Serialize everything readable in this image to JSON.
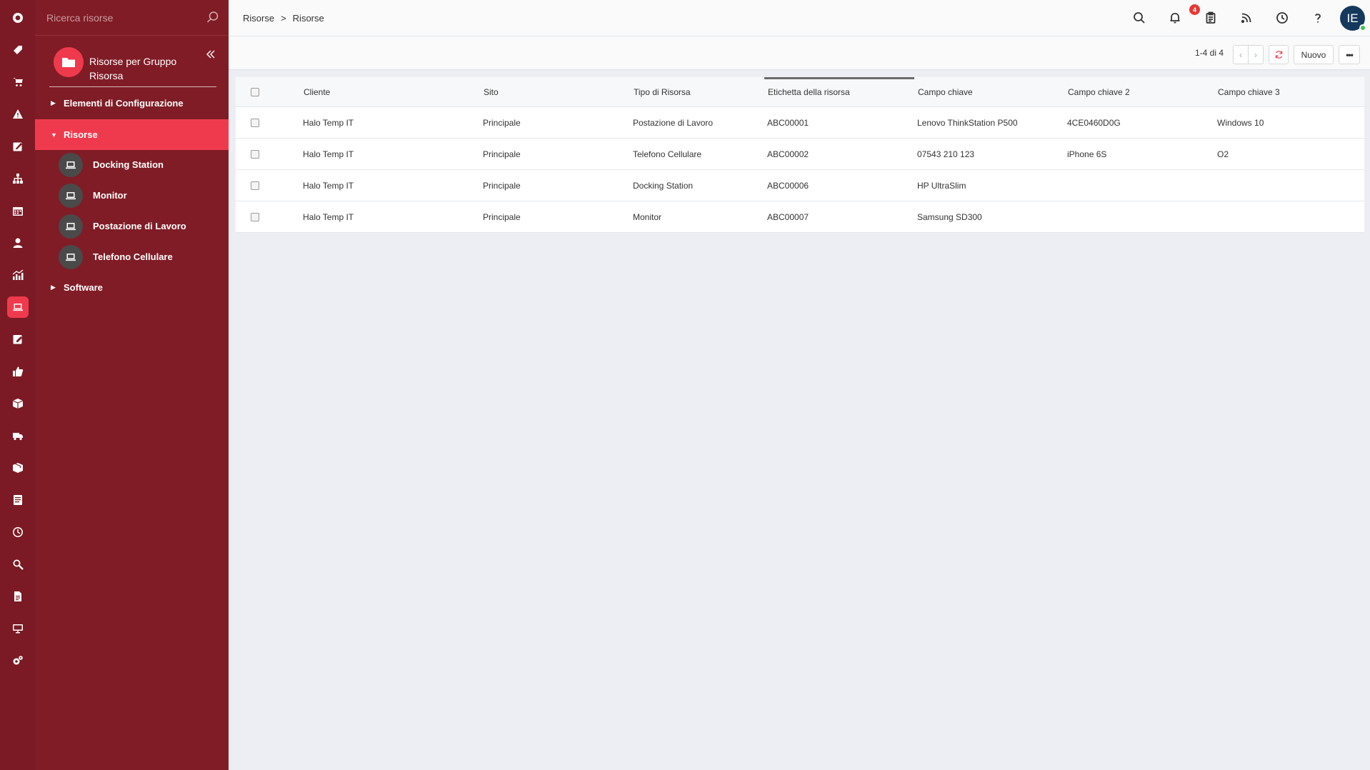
{
  "rail": {
    "items": [
      "tag-icon",
      "cart-icon",
      "warning-icon",
      "edit-icon",
      "sitemap-icon",
      "calendar-icon",
      "user-icon",
      "chart-icon",
      "laptop-icon",
      "note-icon",
      "thumbs-up-icon",
      "box-icon",
      "truck-icon",
      "package-icon",
      "document-icon",
      "clock-icon",
      "search-icon",
      "file-icon",
      "monitor-icon",
      "settings-icon"
    ],
    "active": "laptop-icon"
  },
  "tree": {
    "search_placeholder": "Ricerca risorse",
    "group_title": "Risorse per Gruppo Risorsa",
    "nodes": [
      {
        "label": "Elementi di Configurazione",
        "expanded": false
      },
      {
        "label": "Risorse",
        "expanded": true
      },
      {
        "label": "Software",
        "expanded": false
      }
    ],
    "children": [
      "Docking Station",
      "Monitor",
      "Postazione di Lavoro",
      "Telefono Cellulare"
    ]
  },
  "header": {
    "breadcrumb": [
      "Risorse",
      ">",
      "Risorse"
    ],
    "notification_count": "4",
    "avatar_initials": "IE",
    "icons": [
      "search-icon",
      "bell-icon",
      "clipboard-icon",
      "rss-icon",
      "clock-icon",
      "help-icon"
    ]
  },
  "toolbar": {
    "count": "1-4 di 4",
    "new_label": "Nuovo",
    "more_label": "•••"
  },
  "table": {
    "columns": [
      "Cliente",
      "Sito",
      "Tipo di Risorsa",
      "Etichetta della risorsa",
      "Campo chiave",
      "Campo chiave 2",
      "Campo chiave 3"
    ],
    "sorted_column": "Etichetta della risorsa",
    "rows": [
      [
        "Halo Temp IT",
        "Principale",
        "Postazione di Lavoro",
        "ABC00001",
        "Lenovo ThinkStation P500",
        "4CE0460D0G",
        "Windows 10"
      ],
      [
        "Halo Temp IT",
        "Principale",
        "Telefono Cellulare",
        "ABC00002",
        "07543 210 123",
        "iPhone 6S",
        "O2"
      ],
      [
        "Halo Temp IT",
        "Principale",
        "Docking Station",
        "ABC00006",
        "HP UltraSlim",
        "",
        ""
      ],
      [
        "Halo Temp IT",
        "Principale",
        "Monitor",
        "ABC00007",
        "Samsung SD300",
        "",
        ""
      ]
    ]
  },
  "colors": {
    "rail_bg": "#7b1a24",
    "tree_bg": "#801c26",
    "accent": "#ef3a4d",
    "avatar_bg": "#15395c"
  }
}
